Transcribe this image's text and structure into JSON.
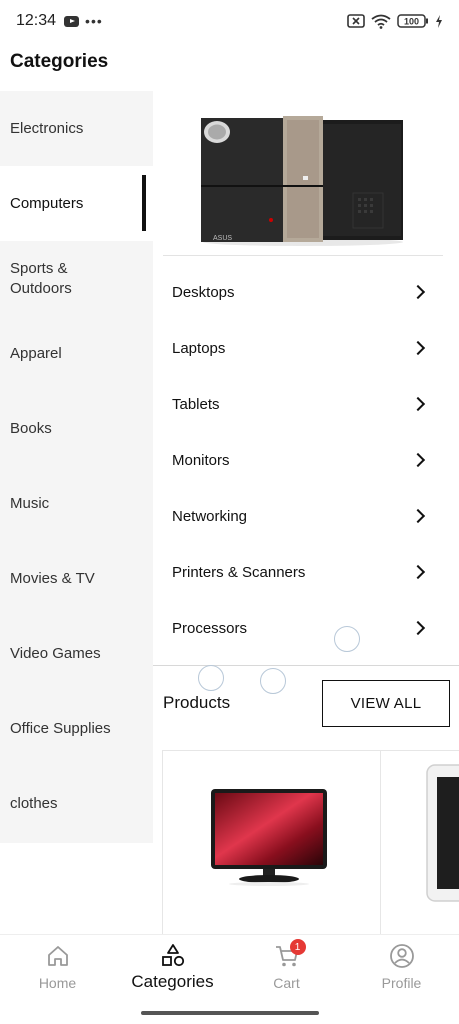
{
  "status_bar": {
    "time": "12:34",
    "battery": "100"
  },
  "header": {
    "title": "Categories"
  },
  "sidebar": {
    "items": [
      {
        "label": "Electronics"
      },
      {
        "label": "Computers",
        "active": true
      },
      {
        "label": "Sports &\nOutdoors"
      },
      {
        "label": "Apparel"
      },
      {
        "label": "Books"
      },
      {
        "label": "Music"
      },
      {
        "label": "Movies & TV"
      },
      {
        "label": "Video Games"
      },
      {
        "label": "Office Supplies"
      },
      {
        "label": "clothes"
      }
    ]
  },
  "subcategories": {
    "items": [
      {
        "label": "Desktops"
      },
      {
        "label": "Laptops"
      },
      {
        "label": "Tablets"
      },
      {
        "label": "Monitors"
      },
      {
        "label": "Networking"
      },
      {
        "label": "Printers & Scanners"
      },
      {
        "label": "Processors"
      }
    ]
  },
  "products": {
    "title": "Products",
    "view_all_label": "VIEW ALL"
  },
  "bottom_nav": {
    "items": [
      {
        "label": "Home",
        "icon": "home-icon"
      },
      {
        "label": "Categories",
        "icon": "categories-icon",
        "active": true
      },
      {
        "label": "Cart",
        "icon": "cart-icon",
        "badge": "1"
      },
      {
        "label": "Profile",
        "icon": "profile-icon"
      }
    ]
  },
  "colors": {
    "accent": "#111111",
    "sidebar_bg": "#f5f5f5",
    "badge": "#e53935",
    "inactive_nav": "#999999"
  }
}
